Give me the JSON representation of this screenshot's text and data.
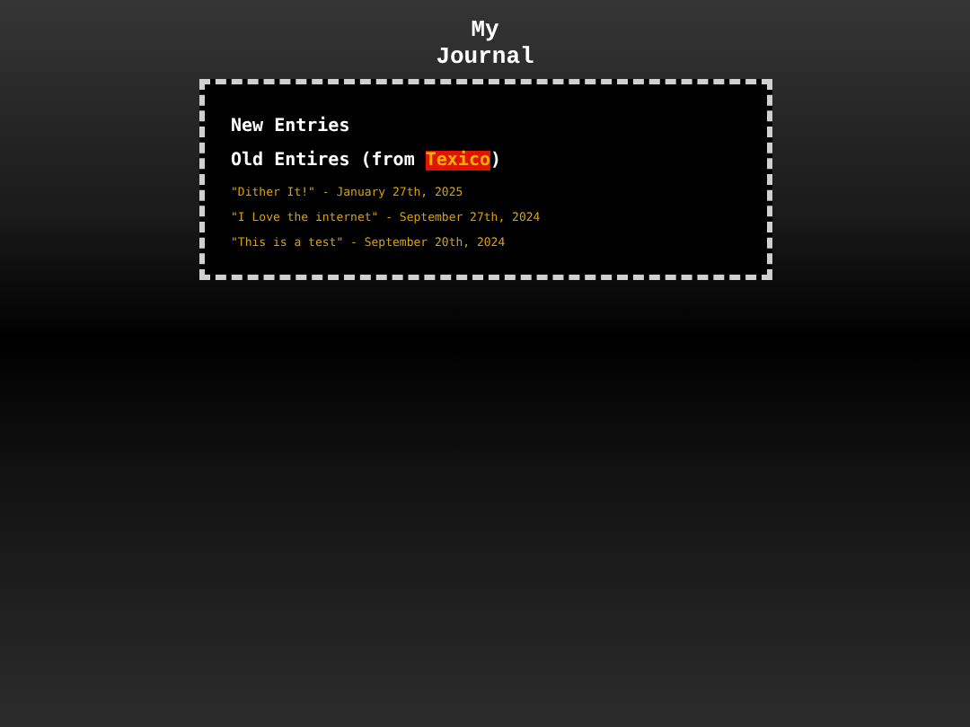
{
  "title": "My Journal",
  "sections": [
    {
      "kind": "plain",
      "text": "New Entries"
    },
    {
      "kind": "linked",
      "before": "Old Entires (from ",
      "link": "Texico",
      "after": ")"
    }
  ],
  "entries": [
    {
      "text": "\"Dither It!\" - January 27th, 2025"
    },
    {
      "text": "\"I Love the internet\" - September 27th, 2024"
    },
    {
      "text": "\"This is a test\" - September 20th, 2024"
    }
  ]
}
